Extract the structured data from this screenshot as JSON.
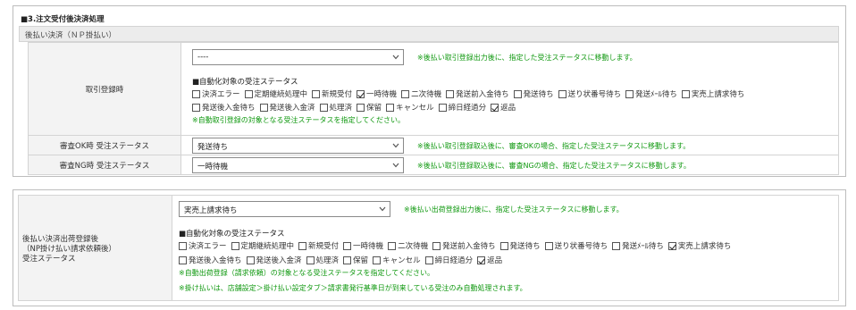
{
  "section_title": "■3.注文受付後決済処理",
  "subheader": "後払い決済（ＮＰ掛払い）",
  "torihiki": {
    "label": "取引登録時",
    "select_value": "----",
    "note": "※後払い取引登録出力後に、指定した受注ステータスに移動します。",
    "status_title": "■自動化対象の受注ステータス",
    "statuses_line1": [
      {
        "label": "決済エラー",
        "checked": false
      },
      {
        "label": "定期継続処理中",
        "checked": false
      },
      {
        "label": "新規受付",
        "checked": false
      },
      {
        "label": "一時待機",
        "checked": true
      },
      {
        "label": "二次待機",
        "checked": false
      },
      {
        "label": "発送前入金待ち",
        "checked": false
      },
      {
        "label": "発送待ち",
        "checked": false
      },
      {
        "label": "送り状番号待ち",
        "checked": false
      },
      {
        "label": "発送ﾒｰﾙ待ち",
        "checked": false
      },
      {
        "label": "実売上請求待ち",
        "checked": false
      }
    ],
    "statuses_line2": [
      {
        "label": "発送後入金待ち",
        "checked": false
      },
      {
        "label": "発送後入金済",
        "checked": false
      },
      {
        "label": "処理済",
        "checked": false
      },
      {
        "label": "保留",
        "checked": false
      },
      {
        "label": "キャンセル",
        "checked": false
      },
      {
        "label": "締日経過分",
        "checked": false
      },
      {
        "label": "返品",
        "checked": true
      }
    ],
    "status_note": "※自動取引登録の対象となる受注ステータスを指定してください。"
  },
  "ok": {
    "label": "審査OK時 受注ステータス",
    "select_value": "発送待ち",
    "note": "※後払い取引登録取込後に、審査OKの場合、指定した受注ステータスに移動します。"
  },
  "ng": {
    "label": "審査NG時 受注ステータス",
    "select_value": "一時待機",
    "note": "※後払い取引登録取込後に、審査NGの場合、指定した受注ステータスに移動します。"
  },
  "panel2": {
    "label_line1": "後払い決済出荷登録後",
    "label_line2": "（NP掛け払い請求依頼後）",
    "label_line3": "受注ステータス",
    "select_value": "実売上請求待ち",
    "note": "※後払い出荷登録出力後に、指定した受注ステータスに移動します。",
    "status_title": "■自動化対象の受注ステータス",
    "statuses_line1": [
      {
        "label": "決済エラー",
        "checked": false
      },
      {
        "label": "定期継続処理中",
        "checked": false
      },
      {
        "label": "新規受付",
        "checked": false
      },
      {
        "label": "一時待機",
        "checked": false
      },
      {
        "label": "二次待機",
        "checked": false
      },
      {
        "label": "発送前入金待ち",
        "checked": false
      },
      {
        "label": "発送待ち",
        "checked": false
      },
      {
        "label": "送り状番号待ち",
        "checked": false
      },
      {
        "label": "発送ﾒｰﾙ待ち",
        "checked": false
      },
      {
        "label": "実売上請求待ち",
        "checked": true
      }
    ],
    "statuses_line2": [
      {
        "label": "発送後入金待ち",
        "checked": false
      },
      {
        "label": "発送後入金済",
        "checked": false
      },
      {
        "label": "処理済",
        "checked": false
      },
      {
        "label": "保留",
        "checked": false
      },
      {
        "label": "キャンセル",
        "checked": false
      },
      {
        "label": "締日経過分",
        "checked": false
      },
      {
        "label": "返品",
        "checked": true
      }
    ],
    "status_note": "※自動出荷登録（請求依頼）の対象となる受注ステータスを指定してください。",
    "kakebarai_note": "※掛け払いは、店舗設定＞掛け払い設定タブ＞請求書発行基準日が到来している受注のみ自動処理されます。"
  }
}
